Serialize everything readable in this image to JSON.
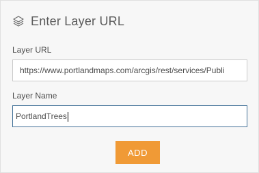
{
  "header": {
    "icon": "layers-icon",
    "title": "Enter Layer URL"
  },
  "layer_url": {
    "label": "Layer URL",
    "value": "https://www.portlandmaps.com/arcgis/rest/services/Publi"
  },
  "layer_name": {
    "label": "Layer Name",
    "value": "PortlandTrees"
  },
  "add_button": {
    "label": "ADD",
    "color": "#f09a36"
  }
}
